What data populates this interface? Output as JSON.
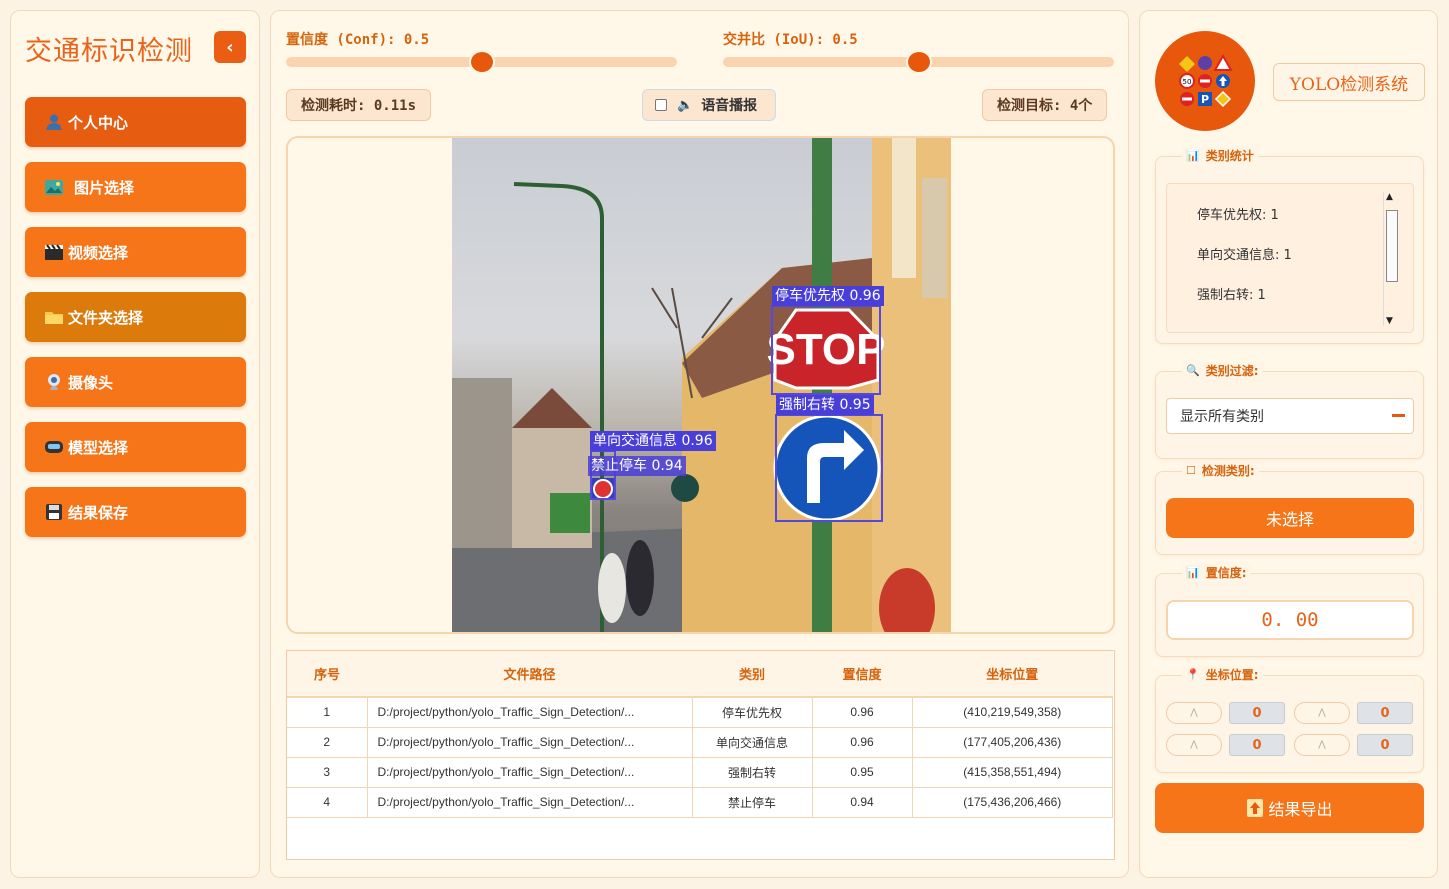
{
  "app": {
    "title": "交通标识检测",
    "collapse_icon": "chevron-left-icon"
  },
  "nav": [
    {
      "label": "个人中心",
      "icon": "user-icon"
    },
    {
      "label": "图片选择",
      "icon": "image-icon"
    },
    {
      "label": "视频选择",
      "icon": "clapper-icon"
    },
    {
      "label": "文件夹选择",
      "icon": "folder-icon"
    },
    {
      "label": "摄像头",
      "icon": "webcam-icon"
    },
    {
      "label": "模型选择",
      "icon": "model-icon"
    },
    {
      "label": "结果保存",
      "icon": "floppy-disk-icon"
    }
  ],
  "controls": {
    "conf_label": "置信度 (Conf): 0.5",
    "conf_value": 0.5,
    "iou_label": "交并比 (IoU): 0.5",
    "iou_value": 0.5,
    "time_label": "检测耗时: 0.11s",
    "voice_label": "语音播报",
    "voice_checked": false,
    "targets_label": "检测目标: 4个"
  },
  "detections": [
    {
      "label": "停车优先权 0.96"
    },
    {
      "label": "强制右转 0.95"
    },
    {
      "label": "单向交通信息 0.96"
    },
    {
      "label": "禁止停车 0.94"
    }
  ],
  "photo_text": {
    "stop": "STOP"
  },
  "table": {
    "headers": [
      "序号",
      "文件路径",
      "类别",
      "置信度",
      "坐标位置"
    ],
    "rows": [
      [
        "1",
        "D:/project/python/yolo_Traffic_Sign_Detection/...",
        "停车优先权",
        "0.96",
        "(410,219,549,358)"
      ],
      [
        "2",
        "D:/project/python/yolo_Traffic_Sign_Detection/...",
        "单向交通信息",
        "0.96",
        "(177,405,206,436)"
      ],
      [
        "3",
        "D:/project/python/yolo_Traffic_Sign_Detection/...",
        "强制右转",
        "0.95",
        "(415,358,551,494)"
      ],
      [
        "4",
        "D:/project/python/yolo_Traffic_Sign_Detection/...",
        "禁止停车",
        "0.94",
        "(175,436,206,466)"
      ]
    ]
  },
  "right": {
    "system_title": "YOLO检测系统",
    "stats_title": "类别统计",
    "stats": [
      "停车优先权: 1",
      "单向交通信息: 1",
      "强制右转: 1"
    ],
    "filter_title": "类别过滤:",
    "filter_value": "显示所有类别",
    "detect_title": "检测类别:",
    "detect_button": "未选择",
    "conf_title": "置信度:",
    "conf_value": "0. 00",
    "coord_title": "坐标位置:",
    "coords": {
      "xmin": "0",
      "ymin": "0",
      "xmax": "0",
      "ymax": "0"
    },
    "export_label": "结果导出"
  },
  "colors": {
    "accent": "#f77519",
    "accent_dark": "#e65c10",
    "box": "#5548e0"
  }
}
